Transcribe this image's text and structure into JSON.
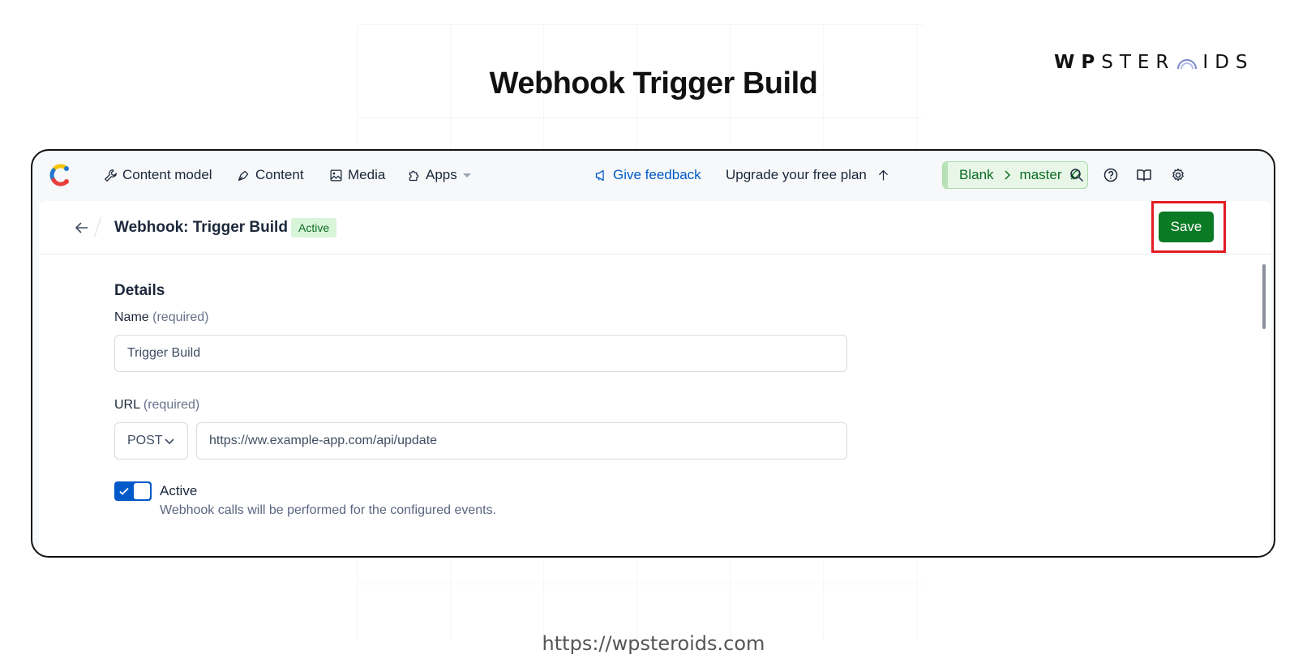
{
  "brand": {
    "bold_part": "WP",
    "light_part_1": "STER",
    "light_part_2": "IDS"
  },
  "page_title": "Webhook Trigger Build",
  "footer_url": "https://wpsteroids.com",
  "nav": {
    "items": [
      {
        "label": "Content model",
        "icon": "wrench-icon"
      },
      {
        "label": "Content",
        "icon": "pen-nib-icon"
      },
      {
        "label": "Media",
        "icon": "image-icon"
      },
      {
        "label": "Apps",
        "icon": "puzzle-icon"
      }
    ],
    "feedback": "Give feedback",
    "upgrade": "Upgrade your free plan",
    "env": {
      "space": "Blank",
      "environment": "master"
    },
    "tools": [
      "search-icon",
      "help-icon",
      "book-icon",
      "gear-icon"
    ]
  },
  "header": {
    "title": "Webhook: Trigger Build",
    "status_badge": "Active",
    "save_label": "Save"
  },
  "form": {
    "section_title": "Details",
    "name": {
      "label": "Name",
      "required": "(required)",
      "value": "Trigger Build"
    },
    "url": {
      "label": "URL",
      "required": "(required)",
      "method": "POST",
      "value": "https://ww.example-app.com/api/update"
    },
    "active": {
      "label": "Active",
      "help": "Webhook calls will be performed for the configured events.",
      "checked": true
    }
  },
  "colors": {
    "accent_blue": "#0059c8",
    "save_green": "#0b7a25",
    "highlight_red": "#e21b24"
  }
}
